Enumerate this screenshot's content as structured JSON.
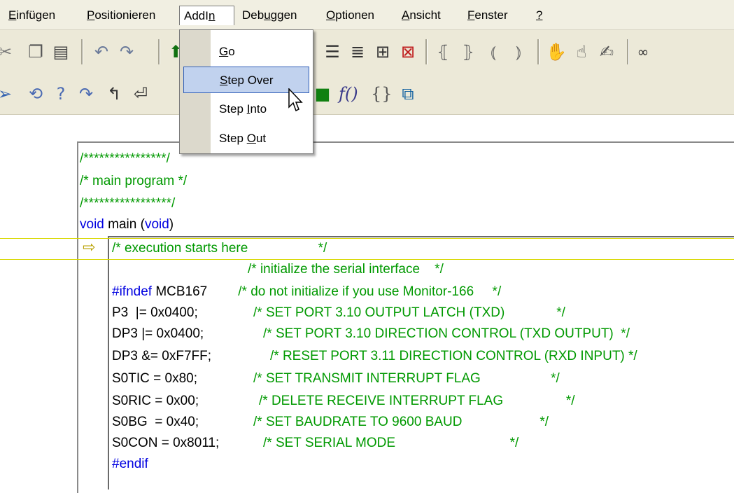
{
  "menubar": {
    "items": [
      {
        "label_pre": "",
        "label_u": "E",
        "label_post": "infügen"
      },
      {
        "label_pre": "",
        "label_u": "P",
        "label_post": "ositionieren"
      },
      {
        "label_pre": "AddI",
        "label_u": "n",
        "label_post": ""
      },
      {
        "label_pre": "Deb",
        "label_u": "u",
        "label_post": "ggen"
      },
      {
        "label_pre": "",
        "label_u": "O",
        "label_post": "ptionen"
      },
      {
        "label_pre": "",
        "label_u": "A",
        "label_post": "nsicht"
      },
      {
        "label_pre": "",
        "label_u": "F",
        "label_post": "enster"
      },
      {
        "label_pre": "",
        "label_u": "?",
        "label_post": ""
      }
    ]
  },
  "toolbar2": {
    "fn_label": "f()",
    "braces_label": "{}"
  },
  "dropdown": {
    "items": [
      {
        "pre": "",
        "u": "G",
        "post": "o"
      },
      {
        "pre": "",
        "u": "S",
        "post": "tep Over"
      },
      {
        "pre": "Step ",
        "u": "I",
        "post": "nto"
      },
      {
        "pre": "Step ",
        "u": "O",
        "post": "ut"
      }
    ],
    "selected": "Step Over"
  },
  "code": {
    "banner_top": "/****************/",
    "main_comment": "/* main program */",
    "banner_bottom": "/*****************/",
    "main_kw1": "void",
    "main_name": " main (",
    "main_kw2": "void",
    "main_close": ")",
    "line_exec": "/* execution starts here                   */",
    "line_init_comment": "/* initialize the serial interface    */",
    "ifndef_kw": "#ifndef",
    "ifndef_name": " MCB167",
    "ifndef_comment": "/* do not initialize if you use Monitor-166     */",
    "lines": [
      {
        "code": "P3  |= 0x0400;",
        "comment": "/* SET PORT 3.10 OUTPUT LATCH (TXD)              */"
      },
      {
        "code": "DP3 |= 0x0400;",
        "comment": "/* SET PORT 3.10 DIRECTION CONTROL (TXD OUTPUT)  */"
      },
      {
        "code": "DP3 &= 0xF7FF;",
        "comment": "/* RESET PORT 3.11 DIRECTION CONTROL (RXD INPUT) */"
      },
      {
        "code": "S0TIC = 0x80;",
        "comment": "/* SET TRANSMIT INTERRUPT FLAG                   */"
      },
      {
        "code": "S0RIC = 0x00;",
        "comment": "/* DELETE RECEIVE INTERRUPT FLAG                 */"
      },
      {
        "code": "S0BG  = 0x40;",
        "comment": "/* SET BAUDRATE TO 9600 BAUD                     */"
      },
      {
        "code": "S0CON = 0x8011;",
        "comment": "/* SET SERIAL MODE                               */"
      }
    ],
    "endif_kw": "#endif"
  }
}
